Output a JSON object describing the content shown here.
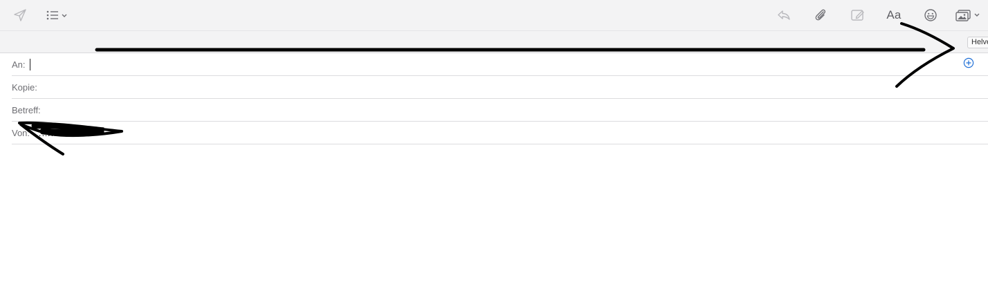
{
  "toolbar": {
    "send_icon": "paper-plane-icon",
    "list_icon": "bullet-list-icon",
    "reply_icon": "reply-icon",
    "attach_icon": "paperclip-icon",
    "markup_icon": "markup-icon",
    "format_label": "Aa",
    "emoji_icon": "smiley-icon",
    "photo_icon": "photo-browser-icon"
  },
  "format_bar": {
    "font_name": "Helvetica"
  },
  "header_fields": {
    "to_label": "An:",
    "cc_label": "Kopie:",
    "subject_label": "Betreff:",
    "from_label": "Von:",
    "from_value": "………….uk"
  },
  "colors": {
    "toolbar_bg": "#f3f3f4",
    "accent": "#1f6fd6",
    "annotation": "#000000"
  }
}
